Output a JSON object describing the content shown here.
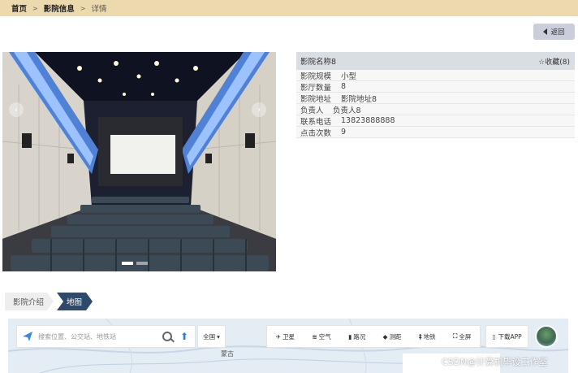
{
  "breadcrumb": {
    "home": "首页",
    "section": "影院信息",
    "current": "详情",
    "sep": ">"
  },
  "actions": {
    "back_label": "返回"
  },
  "carousel": {
    "prev": "‹",
    "next": "›",
    "slides": 2,
    "active_slide": 1
  },
  "cinema": {
    "name": "影院名称8",
    "favorite_label": "☆收藏(8)",
    "fields": [
      {
        "key": "影院规模",
        "value": "小型"
      },
      {
        "key": "影厅数量",
        "value": "8"
      },
      {
        "key": "影院地址",
        "value": "影院地址8"
      },
      {
        "key": "负责人",
        "value": "负责人8"
      },
      {
        "key": "联系电话",
        "value": "13823888888"
      },
      {
        "key": "点击次数",
        "value": "9"
      }
    ]
  },
  "tabs": {
    "intro": "影院介绍",
    "map": "地图"
  },
  "map": {
    "search_placeholder": "搜索位置、公交站、地铁站",
    "nation": "全国",
    "tools": [
      "卫星",
      "空气",
      "路况",
      "测距",
      "地铁",
      "全屏"
    ],
    "download_app": "下载APP",
    "place_label": "蒙古"
  },
  "watermark": "CSDN@计算机毕设工作室",
  "colors": {
    "breadcrumb_bg": "#ecd9ad",
    "active_tab": "#2e4a6a",
    "back_button": "#c9ceda"
  }
}
